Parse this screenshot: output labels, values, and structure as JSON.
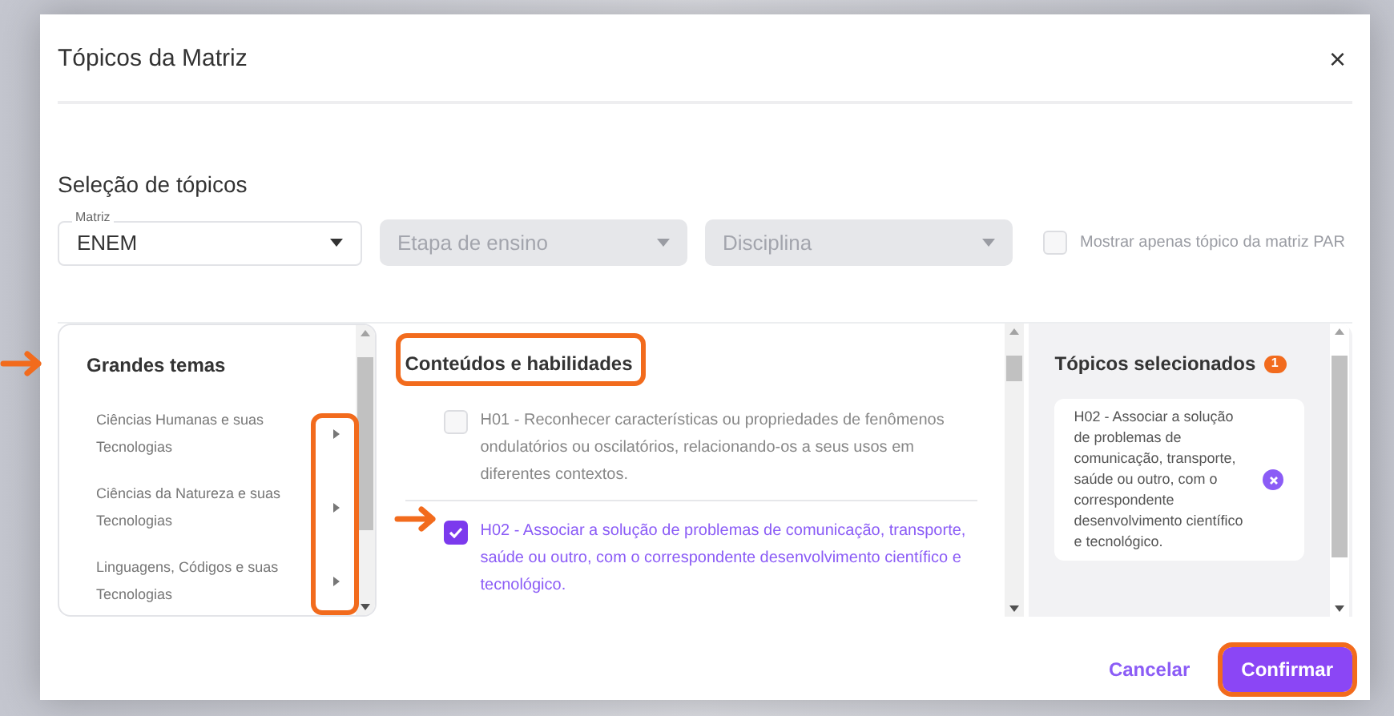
{
  "dialog": {
    "title": "Tópicos da Matriz",
    "close": "×"
  },
  "section_title": "Seleção de tópicos",
  "filters": [
    {
      "label": "Matriz",
      "value": "ENEM",
      "disabled": false
    },
    {
      "placeholder": "Etapa de ensino",
      "disabled": true
    },
    {
      "placeholder": "Disciplina",
      "disabled": true
    }
  ],
  "par_only": {
    "label": "Mostrar apenas tópico da matriz PAR",
    "checked": false
  },
  "themes": {
    "title": "Grandes temas",
    "items": [
      {
        "label": "Ciências Humanas e suas Tecnologias"
      },
      {
        "label": "Ciências da Natureza e suas Tecnologias"
      },
      {
        "label": "Linguagens, Códigos e suas Tecnologias"
      }
    ]
  },
  "contents": {
    "title": "Conteúdos e habilidades",
    "items": [
      {
        "text": "H01 - Reconhecer características ou propriedades de fenômenos ondulatórios ou oscilatórios, relacionando-os a seus usos em diferentes contextos.",
        "checked": false
      },
      {
        "text": "H02 - Associar a solução de problemas de comunicação, transporte, saúde ou outro, com o correspondente desenvolvimento científico e tecnológico.",
        "checked": true
      }
    ]
  },
  "selected": {
    "title": "Tópicos selecionados",
    "count": "1",
    "items": [
      {
        "text": "H02 - Associar a solução de problemas de comunicação, transporte, saúde ou outro, com o correspondente desenvolvimento científico e tecnológico."
      }
    ]
  },
  "buttons": [
    {
      "label": "Cancelar",
      "kind": "text"
    },
    {
      "label": "Confirmar",
      "kind": "primary"
    }
  ]
}
